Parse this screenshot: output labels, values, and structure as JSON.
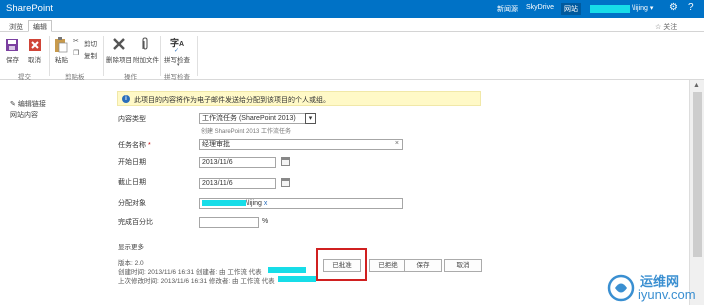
{
  "suite": {
    "brand": "SharePoint",
    "links": [
      "新闻源",
      "SkyDrive",
      "网站"
    ],
    "user": "\\lijing",
    "gear_icon": "gear-icon",
    "help_icon": "help-icon"
  },
  "tabs": {
    "browse": "浏览",
    "edit": "编辑",
    "share": "关注"
  },
  "ribbon": {
    "save": "保存",
    "cancel": "取消",
    "paste": "粘贴",
    "cut": "剪切",
    "copy": "复制",
    "delete_item": "删除项目",
    "attach_file": "附加文件",
    "spelling": "拼写检查",
    "groups": {
      "commit": "提交",
      "clipboard": "剪贴板",
      "actions": "操作",
      "spelling": "拼写检查"
    }
  },
  "leftnav": {
    "edit_links": "编辑链接",
    "site_contents": "网站内容"
  },
  "notice": "此项目的内容将作为电子邮件发送给分配到该项目的个人或组。",
  "form": {
    "content_type_label": "内容类型",
    "content_type_value": "工作流任务 (SharePoint 2013)",
    "content_type_hint": "创建 SharePoint 2013 工作流任务",
    "task_name_label": "任务名称",
    "required_mark": "*",
    "task_name_value": "经理审批",
    "clear_icon": "×",
    "start_date_label": "开始日期",
    "start_date_value": "2013/11/6",
    "due_date_label": "截止日期",
    "due_date_value": "2013/11/6",
    "assigned_label": "分配对象",
    "assigned_value": "\\lijing",
    "assigned_remove": "x",
    "percent_label": "完成百分比",
    "percent_unit": "%",
    "show_more": "显示更多"
  },
  "meta": {
    "version": "版本: 2.0",
    "created": "创建时间: 2013/11/6 16:31  创建者: 由 工作流 代表",
    "modified": "上次修改时间: 2013/11/6 16:31  修改者: 由 工作流 代表"
  },
  "buttons": {
    "approve": "已批准",
    "reject": "已拒绝",
    "save": "保存",
    "cancel": "取消"
  },
  "watermark": {
    "line1": "运维网",
    "line2": "iyunv.com"
  },
  "colors": {
    "suitebar": "#0072c6",
    "accent": "#d02020",
    "redaction": "#17dde8"
  }
}
